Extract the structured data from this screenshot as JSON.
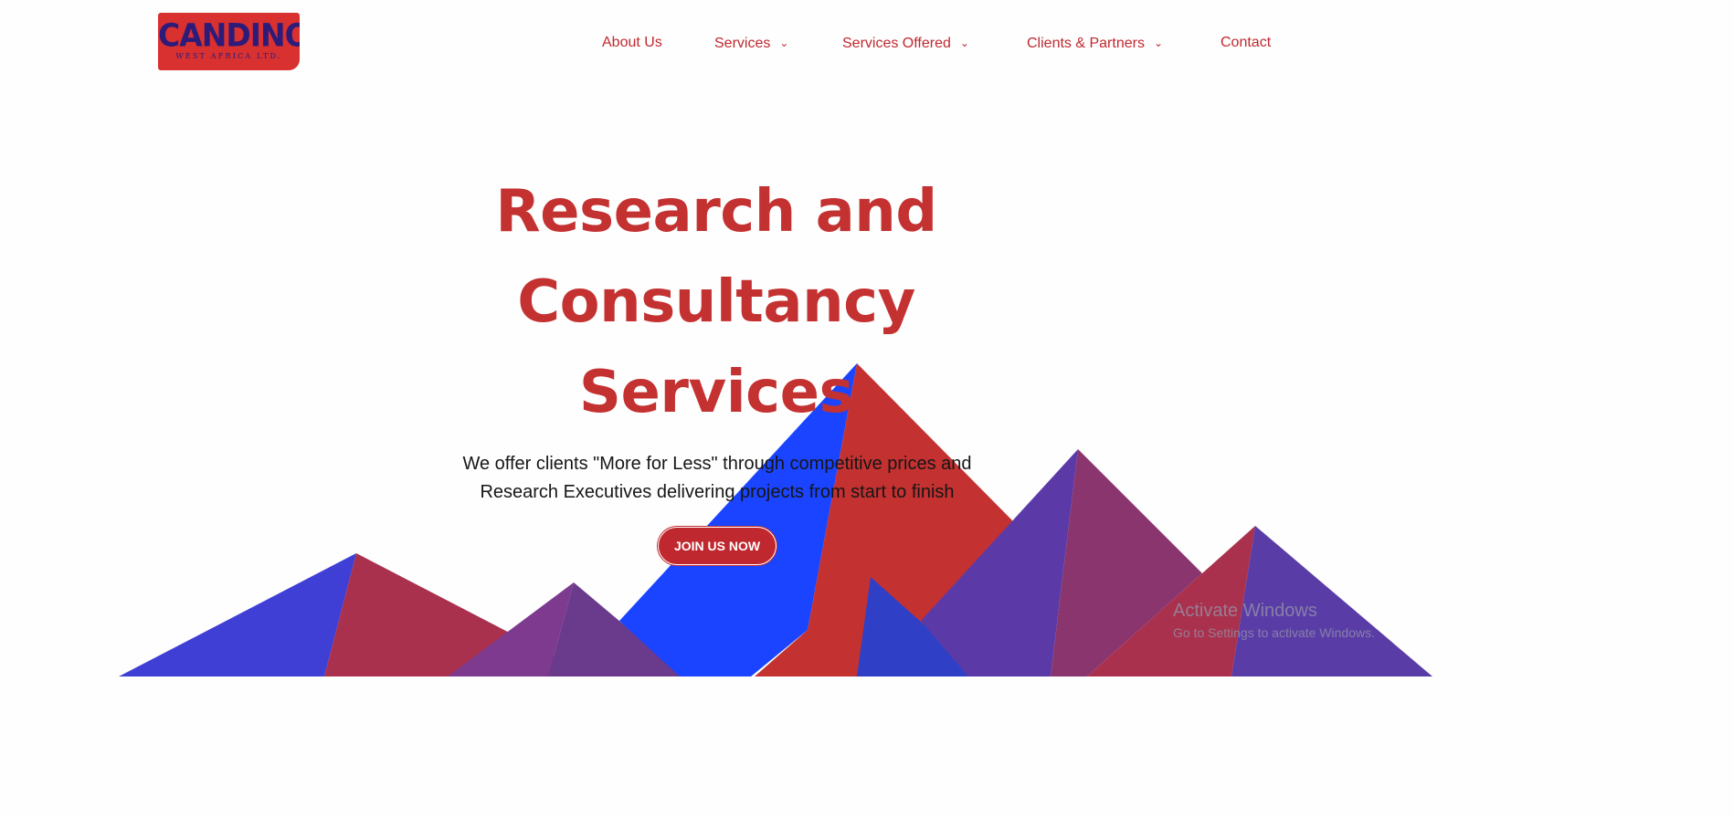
{
  "brand": {
    "name": "CANDINO",
    "subtitle": "WEST AFRICA LTD."
  },
  "nav": {
    "items": [
      {
        "label": "About Us",
        "has_dropdown": false
      },
      {
        "label": "Services",
        "has_dropdown": true
      },
      {
        "label": "Services Offered",
        "has_dropdown": true
      },
      {
        "label": "Clients & Partners",
        "has_dropdown": true
      },
      {
        "label": "Contact",
        "has_dropdown": false
      }
    ],
    "dropdown_glyph": "⌄"
  },
  "hero": {
    "title_lines": [
      "Research and",
      "Consultancy",
      "Services"
    ],
    "subtitle_lines": [
      "We offer clients \"More for Less\" through competitive prices and",
      "Research Executives delivering projects from start to finish"
    ],
    "cta_label": "JOIN US NOW"
  },
  "watermark": {
    "title": "Activate Windows",
    "subtitle": "Go to Settings to activate Windows."
  },
  "colors": {
    "brand_red": "#c43131",
    "brand_blue": "#1a44ff",
    "brand_purple": "#5b3aa8",
    "background": "#fefefe"
  }
}
